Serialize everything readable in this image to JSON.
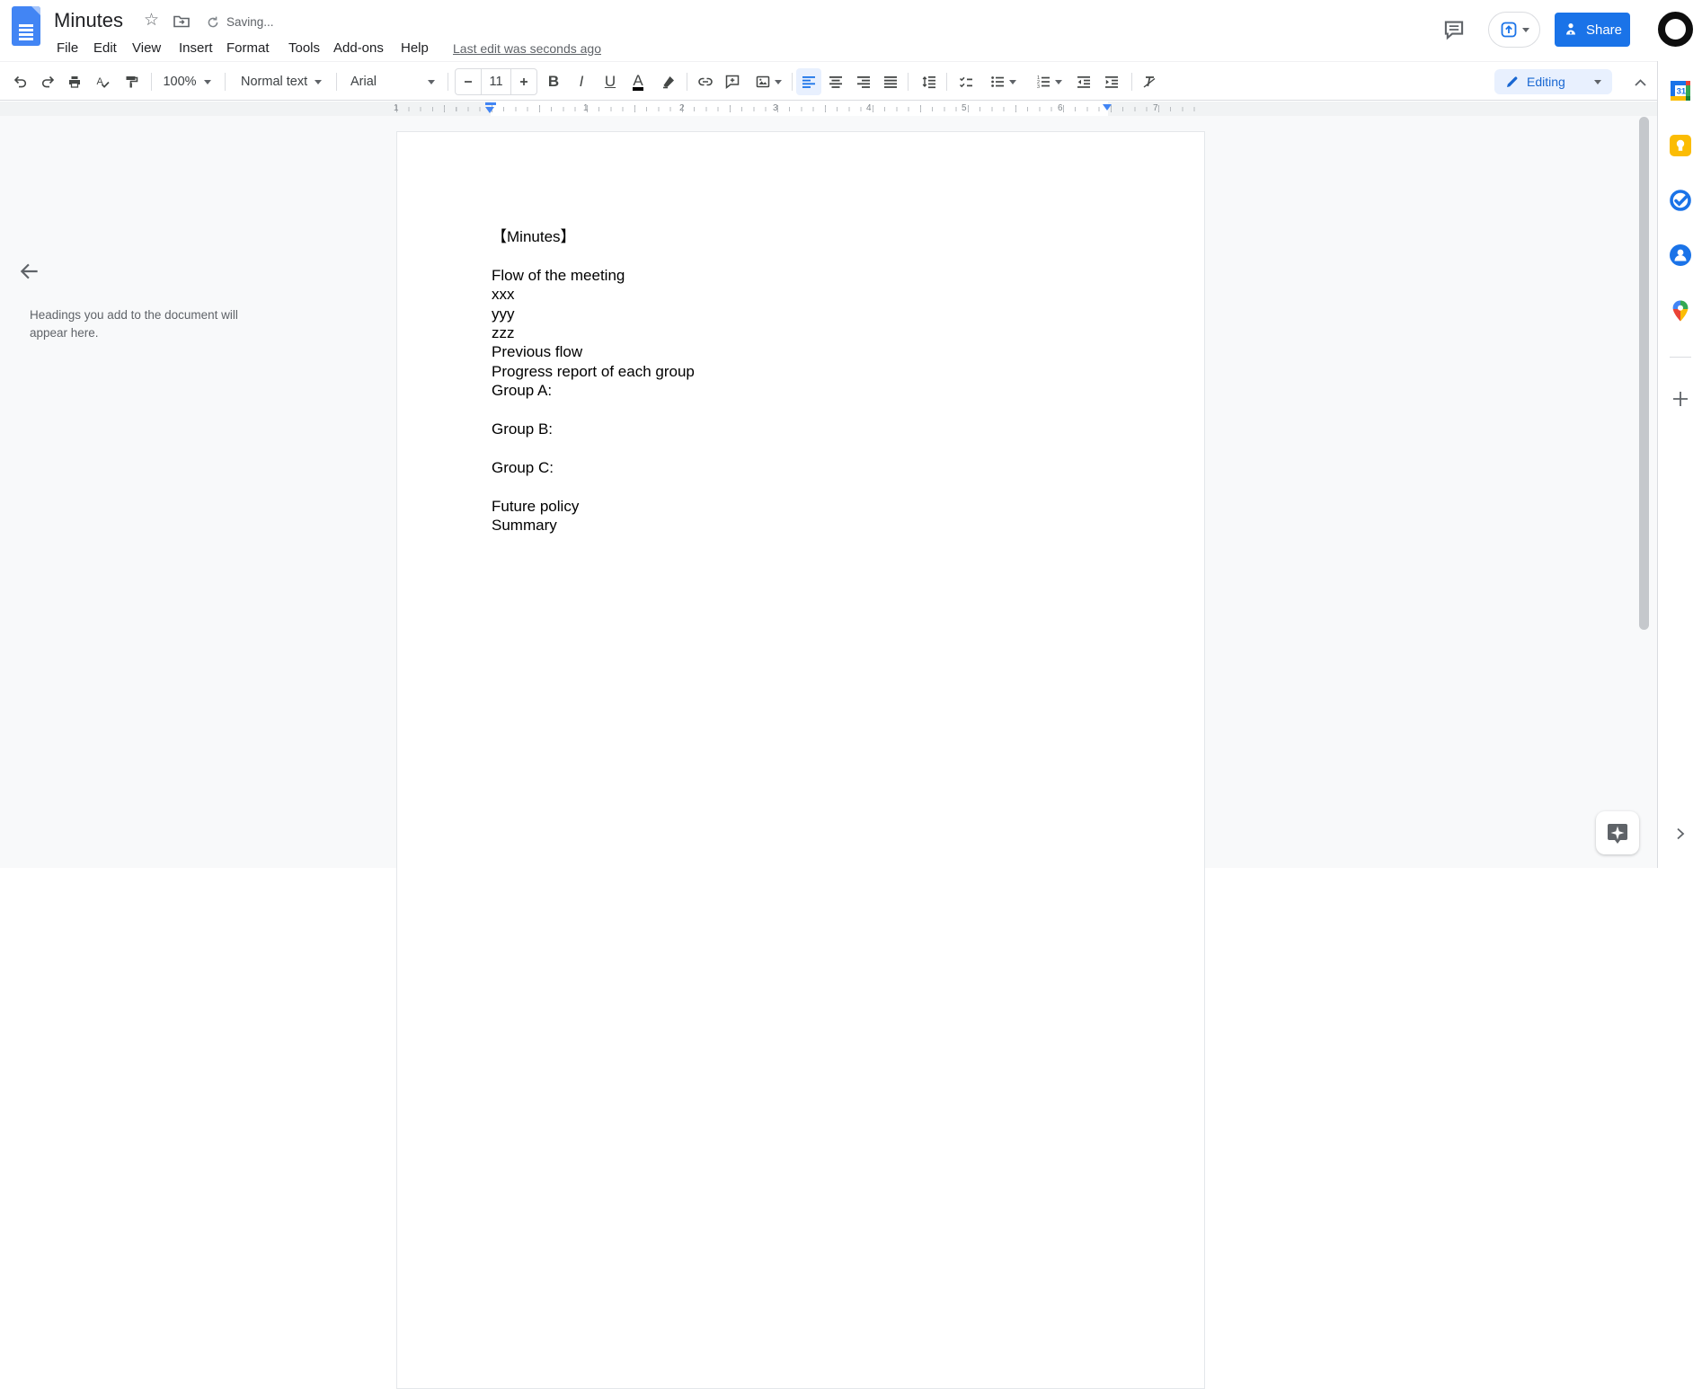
{
  "titlebar": {
    "title": "Minutes",
    "saving_status": "Saving...",
    "menus": [
      "File",
      "Edit",
      "View",
      "Insert",
      "Format",
      "Tools",
      "Add-ons",
      "Help"
    ],
    "last_edit": "Last edit was seconds ago",
    "share_label": "Share"
  },
  "toolbar": {
    "zoom_value": "100%",
    "style_value": "Normal text",
    "font_value": "Arial",
    "font_size_value": "11",
    "mode_label": "Editing"
  },
  "outline_panel": {
    "placeholder": "Headings you add to the document will appear here."
  },
  "ruler": {
    "numbers": [
      "1",
      "1",
      "2",
      "3",
      "4",
      "5",
      "6",
      "7"
    ]
  },
  "document": {
    "lines": [
      "【Minutes】",
      "",
      "Flow of the meeting",
      "xxx",
      "yyy",
      "zzz",
      "Previous flow",
      "Progress report of each group",
      "Group A:",
      "",
      "Group B:",
      "",
      "Group C:",
      "",
      "Future policy",
      "Summary"
    ]
  },
  "icons": {
    "bold_glyph": "B",
    "italic_glyph": "I",
    "underline_glyph": "U",
    "text_color_glyph": "A",
    "spellcheck_glyph": "A",
    "plus_glyph": "+",
    "star_glyph": "☆",
    "calendar_glyph": "31"
  },
  "colors": {
    "accent_blue": "#1a73e8",
    "active_bg": "#e8f0fe",
    "icon_gray": "#444746",
    "chrome_border": "#dadce0"
  }
}
